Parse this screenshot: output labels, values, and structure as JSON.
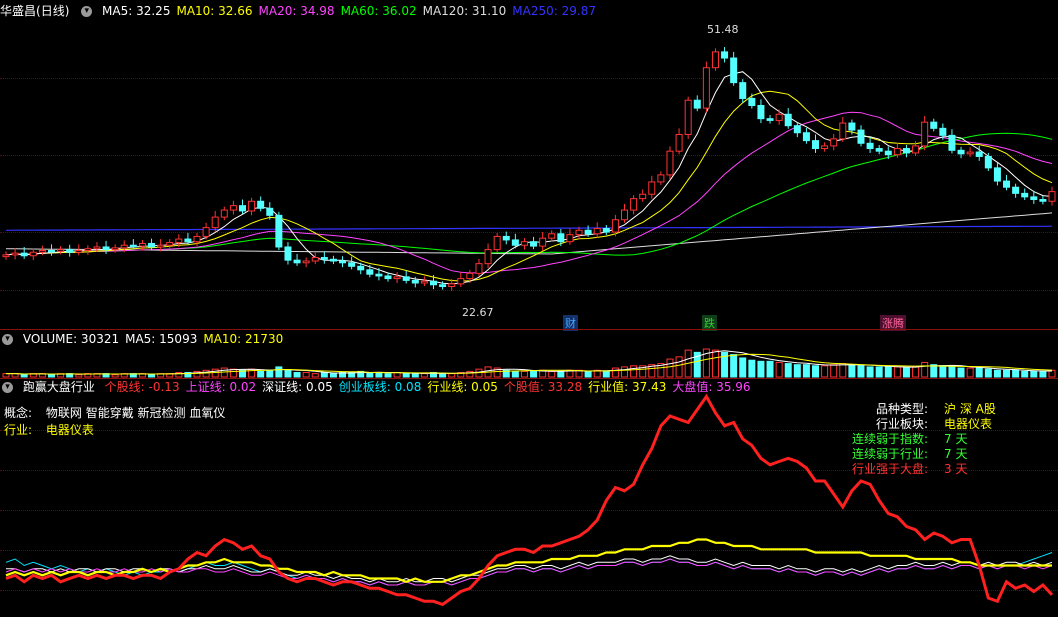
{
  "stock": {
    "name": "华盛昌",
    "period": "(日线)"
  },
  "price_ma": [
    {
      "label": "MA5:",
      "value": "32.25",
      "color": "#ffffff"
    },
    {
      "label": "MA10:",
      "value": "32.66",
      "color": "#ffff00"
    },
    {
      "label": "MA20:",
      "value": "34.98",
      "color": "#ff44ff"
    },
    {
      "label": "MA60:",
      "value": "36.02",
      "color": "#00ff00"
    },
    {
      "label": "MA120:",
      "value": "31.10",
      "color": "#dddddd"
    },
    {
      "label": "MA250:",
      "value": "29.87",
      "color": "#3333ff"
    }
  ],
  "price_high": "51.48",
  "price_low": "22.67",
  "event_markers": [
    {
      "text": "财",
      "color": "#3fa9ff",
      "bg": "#14306a"
    },
    {
      "text": "跌",
      "color": "#33cc33",
      "bg": "#0f3e18"
    },
    {
      "text": "涨腾",
      "color": "#ff6699",
      "bg": "#4e1030"
    }
  ],
  "volume_header": [
    {
      "label": "VOLUME:",
      "value": "30321",
      "color": "#ffffff"
    },
    {
      "label": "MA5:",
      "value": "15093",
      "color": "#ffffff"
    },
    {
      "label": "MA10:",
      "value": "21730",
      "color": "#ffff00"
    }
  ],
  "indicator_header": {
    "title": "跑赢大盘行业",
    "items": [
      {
        "label": "个股线:",
        "value": "-0.13",
        "color": "#ff3333"
      },
      {
        "label": "上证线:",
        "value": "0.02",
        "color": "#ff44ff"
      },
      {
        "label": "深证线:",
        "value": "0.05",
        "color": "#ffffff"
      },
      {
        "label": "创业板线:",
        "value": "0.08",
        "color": "#00e5ff"
      },
      {
        "label": "行业线:",
        "value": "0.05",
        "color": "#ffff00"
      },
      {
        "label": "个股值:",
        "value": "33.28",
        "color": "#ff3333"
      },
      {
        "label": "行业值:",
        "value": "37.43",
        "color": "#ffff00"
      },
      {
        "label": "大盘值:",
        "value": "35.96",
        "color": "#ff44ff"
      }
    ]
  },
  "info_left": {
    "concept_label": "概念:",
    "concept_value": "物联网 智能穿戴 新冠检测 血氧仪",
    "industry_label": "行业:",
    "industry_value": "电器仪表"
  },
  "info_right": [
    {
      "label": "品种类型:",
      "value": "沪 深 A股",
      "label_color": "#ffffff",
      "value_color": "#ffff00"
    },
    {
      "label": "行业板块:",
      "value": "电器仪表",
      "label_color": "#ffffff",
      "value_color": "#ffff00"
    },
    {
      "label": "连续弱于指数:",
      "value": "7   天",
      "label_color": "#33ff33",
      "value_color": "#33ff33"
    },
    {
      "label": "连续弱于行业:",
      "value": "7   天",
      "label_color": "#33ff33",
      "value_color": "#33ff33"
    },
    {
      "label": "行业强于大盘:",
      "value": "3   天",
      "label_color": "#ff3333",
      "value_color": "#ff3333"
    }
  ],
  "chart_data": {
    "type": "line",
    "description_none": "",
    "price_range": [
      20,
      53
    ],
    "low_value": 22.67,
    "high_value": 51.48,
    "closes": [
      26.5,
      26.7,
      26.4,
      26.8,
      27.0,
      26.9,
      27.1,
      26.8,
      27.0,
      27.2,
      27.4,
      27.1,
      27.3,
      27.6,
      27.5,
      27.8,
      27.4,
      27.6,
      27.9,
      28.3,
      28.0,
      28.6,
      29.6,
      30.8,
      31.6,
      32.1,
      31.5,
      32.6,
      31.8,
      31.0,
      27.4,
      25.9,
      25.6,
      25.8,
      26.2,
      26.0,
      25.8,
      25.6,
      25.2,
      24.8,
      24.3,
      24.1,
      23.8,
      24.0,
      23.6,
      23.3,
      23.5,
      23.1,
      22.9,
      23.2,
      23.8,
      24.4,
      25.5,
      27.1,
      28.6,
      28.2,
      27.6,
      28.0,
      27.5,
      28.4,
      28.9,
      28.0,
      28.8,
      29.3,
      28.9,
      29.5,
      29.1,
      30.5,
      31.6,
      32.9,
      33.4,
      34.8,
      35.6,
      38.3,
      40.2,
      44.1,
      43.2,
      47.8,
      49.6,
      48.9,
      46.1,
      44.3,
      43.5,
      42.0,
      41.8,
      42.5,
      41.2,
      40.4,
      39.5,
      38.6,
      38.9,
      39.7,
      41.5,
      40.7,
      39.2,
      38.6,
      38.3,
      37.9,
      38.6,
      38.1,
      38.9,
      41.6,
      40.9,
      40.1,
      38.4,
      38.0,
      38.2,
      37.7,
      36.4,
      34.9,
      34.2,
      33.5,
      33.1,
      32.8,
      32.6,
      33.7
    ],
    "volume": [
      3,
      3,
      2,
      3,
      3,
      2,
      3,
      3,
      2,
      3,
      3,
      3,
      2,
      3,
      3,
      3,
      2,
      3,
      3,
      4,
      4,
      5,
      6,
      7,
      8,
      7,
      6,
      7,
      5,
      6,
      9,
      6,
      4,
      4,
      3,
      4,
      3,
      4,
      4,
      5,
      4,
      4,
      3,
      4,
      3,
      3,
      3,
      4,
      3,
      3,
      4,
      5,
      7,
      9,
      8,
      6,
      5,
      5,
      5,
      6,
      5,
      5,
      6,
      6,
      5,
      6,
      5,
      8,
      9,
      10,
      10,
      11,
      12,
      16,
      18,
      24,
      22,
      25,
      24,
      22,
      20,
      17,
      15,
      14,
      14,
      13,
      12,
      11,
      11,
      10,
      10,
      11,
      12,
      11,
      10,
      9,
      9,
      9,
      9,
      8,
      9,
      13,
      11,
      10,
      9,
      8,
      8,
      8,
      7,
      6,
      6,
      6,
      5,
      5,
      5,
      6
    ],
    "stock_line": [
      -2,
      -1,
      -3,
      -1,
      -2,
      -1,
      -3,
      -2,
      -1,
      -2,
      -1,
      -2,
      -1,
      -1,
      -2,
      -1,
      -1,
      -2,
      0,
      1,
      4,
      6,
      5,
      8,
      10,
      9,
      7,
      8,
      5,
      4,
      0,
      -2,
      -3,
      -2,
      -2,
      -3,
      -4,
      -3,
      -3,
      -4,
      -5,
      -5,
      -6,
      -7,
      -7,
      -8,
      -9,
      -9,
      -10,
      -8,
      -6,
      -5,
      -2,
      2,
      5,
      6,
      7,
      7,
      6,
      8,
      8,
      9,
      10,
      11,
      13,
      16,
      22,
      26,
      25,
      27,
      33,
      38,
      45,
      48,
      47,
      46,
      50,
      54,
      49,
      45,
      46,
      41,
      39,
      35,
      33,
      34,
      35,
      34,
      32,
      28,
      28,
      24,
      20,
      25,
      28,
      27,
      22,
      18,
      17,
      14,
      13,
      10,
      12,
      11,
      9,
      10,
      10,
      2,
      -8,
      -9,
      -3,
      -5,
      -4,
      -6,
      -4,
      -7
    ],
    "industry_line": [
      -1,
      0,
      -1,
      0,
      -1,
      0,
      -1,
      0,
      0,
      -1,
      0,
      0,
      -1,
      0,
      0,
      1,
      0,
      1,
      0,
      1,
      2,
      2,
      3,
      3,
      4,
      3,
      3,
      3,
      2,
      2,
      1,
      1,
      0,
      0,
      0,
      -1,
      0,
      -1,
      -1,
      -1,
      -2,
      -2,
      -2,
      -2,
      -3,
      -2,
      -3,
      -3,
      -3,
      -2,
      -1,
      -1,
      0,
      1,
      2,
      2,
      3,
      3,
      3,
      3,
      4,
      4,
      4,
      5,
      5,
      5,
      6,
      6,
      7,
      7,
      7,
      8,
      8,
      8,
      9,
      9,
      10,
      10,
      9,
      9,
      8,
      8,
      8,
      7,
      7,
      7,
      7,
      7,
      7,
      6,
      6,
      6,
      6,
      6,
      6,
      5,
      5,
      5,
      5,
      5,
      4,
      4,
      4,
      4,
      4,
      3,
      3,
      2,
      2,
      2,
      2,
      2,
      2,
      2,
      2,
      2
    ],
    "sh_line": [
      0,
      1,
      0,
      1,
      0,
      1,
      0,
      1,
      0,
      0,
      1,
      0,
      0,
      1,
      0,
      0,
      1,
      0,
      1,
      0,
      0,
      1,
      1,
      0,
      0,
      1,
      0,
      -1,
      -1,
      0,
      -1,
      -2,
      -2,
      -1,
      -2,
      -2,
      -3,
      -2,
      -3,
      -3,
      -4,
      -3,
      -4,
      -4,
      -3,
      -4,
      -4,
      -3,
      -3,
      -4,
      -3,
      -2,
      -2,
      -1,
      0,
      0,
      1,
      1,
      0,
      1,
      1,
      0,
      1,
      2,
      1,
      2,
      2,
      2,
      3,
      3,
      2,
      3,
      3,
      4,
      3,
      3,
      2,
      2,
      3,
      2,
      1,
      2,
      1,
      1,
      1,
      0,
      1,
      0,
      0,
      -1,
      0,
      0,
      -1,
      0,
      -1,
      0,
      1,
      0,
      1,
      1,
      2,
      1,
      1,
      2,
      1,
      2,
      2,
      1,
      2,
      1,
      2,
      2,
      1,
      2,
      1,
      2
    ],
    "sz_line": [
      1,
      1,
      0,
      1,
      1,
      0,
      1,
      0,
      1,
      1,
      0,
      1,
      1,
      0,
      1,
      1,
      0,
      1,
      1,
      0,
      1,
      1,
      2,
      1,
      1,
      2,
      1,
      0,
      0,
      1,
      0,
      -1,
      -1,
      0,
      -1,
      -1,
      -2,
      -1,
      -2,
      -2,
      -3,
      -2,
      -3,
      -3,
      -2,
      -3,
      -3,
      -2,
      -2,
      -3,
      -2,
      -1,
      -1,
      0,
      1,
      1,
      2,
      2,
      1,
      2,
      2,
      1,
      2,
      3,
      2,
      3,
      3,
      3,
      4,
      4,
      3,
      4,
      4,
      5,
      4,
      4,
      3,
      3,
      4,
      3,
      2,
      3,
      2,
      2,
      2,
      1,
      2,
      1,
      1,
      0,
      1,
      1,
      0,
      1,
      0,
      1,
      2,
      1,
      2,
      2,
      3,
      2,
      2,
      3,
      2,
      3,
      3,
      2,
      3,
      2,
      3,
      3,
      2,
      3,
      2,
      3
    ],
    "cy_line": [
      3,
      4,
      2,
      3,
      2,
      1,
      2,
      1,
      0,
      1,
      0,
      1,
      0,
      -1,
      0,
      -1,
      0,
      0,
      1,
      0,
      1,
      2,
      3,
      2,
      2,
      3,
      2,
      1,
      0,
      1,
      0,
      -1,
      -2,
      -1,
      -2,
      -2,
      -3,
      -2,
      -3,
      -3,
      -4,
      -3,
      -4,
      -4,
      -3,
      -4,
      -4,
      -3,
      -3,
      -4,
      -3,
      -2,
      -2,
      -1,
      0,
      0,
      1,
      1,
      0,
      1,
      1,
      0,
      1,
      2,
      1,
      2,
      2,
      2,
      3,
      3,
      2,
      3,
      3,
      4,
      3,
      3,
      2,
      2,
      3,
      2,
      1,
      2,
      1,
      1,
      1,
      0,
      1,
      0,
      0,
      -1,
      0,
      0,
      -1,
      0,
      -1,
      0,
      1,
      0,
      1,
      1,
      2,
      1,
      1,
      2,
      1,
      2,
      2,
      1,
      2,
      1,
      2,
      2,
      3,
      4,
      5,
      6
    ]
  }
}
